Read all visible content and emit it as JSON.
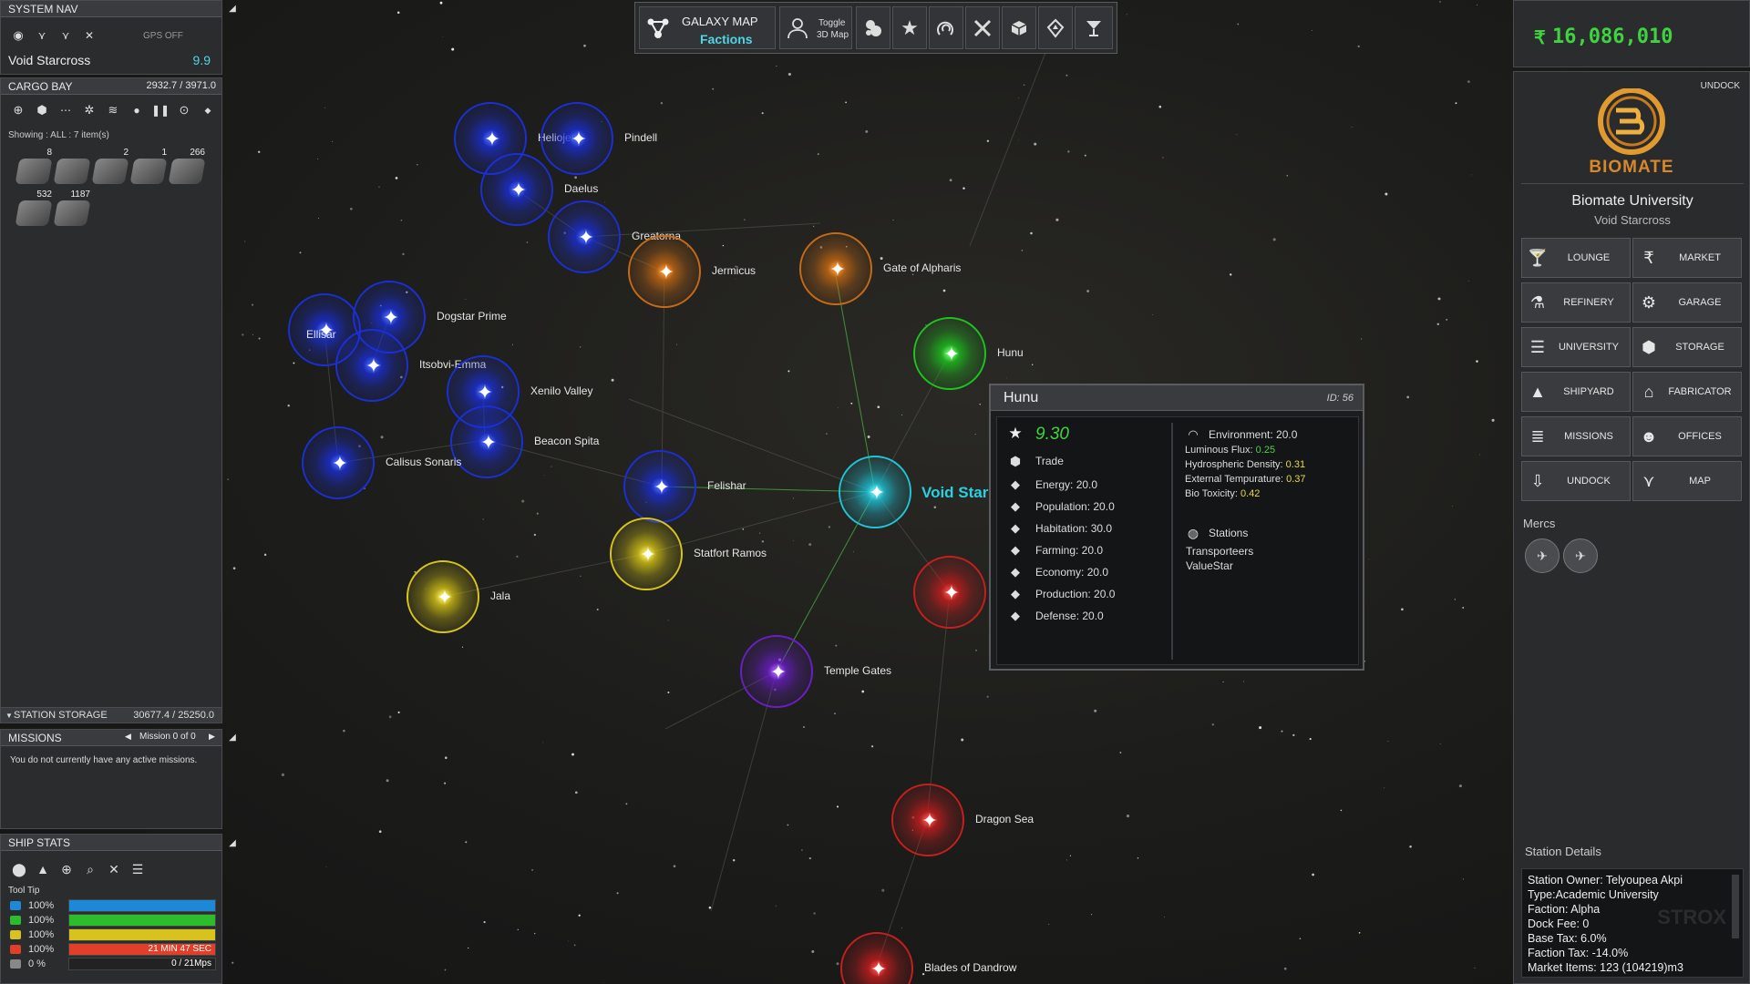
{
  "system_nav": {
    "header": "SYSTEM NAV",
    "gps": "GPS OFF",
    "system_name": "Void Starcross",
    "security": "9.9"
  },
  "cargo_bay": {
    "header": "CARGO BAY",
    "capacity": "2932.7 / 3971.0",
    "showing": "Showing : ALL : 7 item(s)",
    "item_counts": [
      "8",
      "",
      "2",
      "1",
      "266",
      "532",
      "1187"
    ]
  },
  "station_storage": {
    "label": "STATION STORAGE",
    "capacity": "30677.4 / 25250.0"
  },
  "missions": {
    "header": "MISSIONS",
    "nav_label": "Mission 0 of 0",
    "empty_text": "You do not currently have any active missions."
  },
  "ship_stats": {
    "header": "SHIP STATS",
    "tooltip_label": "Tool Tip",
    "rows": [
      {
        "icon": "shield-icon",
        "pct": "100%",
        "bar": "",
        "color": "#1e88d8",
        "fill": 1.0
      },
      {
        "icon": "energy-icon",
        "pct": "100%",
        "bar": "",
        "color": "#2bbd2b",
        "fill": 1.0
      },
      {
        "icon": "bolt-icon",
        "pct": "100%",
        "bar": "",
        "color": "#d8c21e",
        "fill": 1.0
      },
      {
        "icon": "timer-icon",
        "pct": "100%",
        "bar": "21 MIN 47 SEC",
        "color": "#e0402a",
        "fill": 1.0
      },
      {
        "icon": "speed-icon",
        "pct": "0 %",
        "bar": "0 / 21Mps",
        "color": "#555",
        "fill": 0.0
      }
    ]
  },
  "top_bar": {
    "title": "GALAXY MAP",
    "subtitle": "Factions",
    "toggle_line1": "Toggle",
    "toggle_line2": "3D Map"
  },
  "map": {
    "current_system_label": "Void Star",
    "nodes": [
      {
        "name": "Heliojen",
        "color": "blue"
      },
      {
        "name": "Pindell",
        "color": "blue"
      },
      {
        "name": "Daelus",
        "color": "blue"
      },
      {
        "name": "Greatorna",
        "color": "blue"
      },
      {
        "name": "Jermicus",
        "color": "orange"
      },
      {
        "name": "Gate of Alpharis",
        "color": "orange"
      },
      {
        "name": "Hunu",
        "color": "green"
      },
      {
        "name": "Dogstar Prime",
        "color": "blue"
      },
      {
        "name": "Ellisar",
        "color": "blue"
      },
      {
        "name": "Itsobvi-Emma",
        "color": "blue"
      },
      {
        "name": "Xenilo Valley",
        "color": "blue"
      },
      {
        "name": "Beacon Spita",
        "color": "blue"
      },
      {
        "name": "Calisus Sonaris",
        "color": "blue"
      },
      {
        "name": "Felishar",
        "color": "blue"
      },
      {
        "name": "Statfort Ramos",
        "color": "yellow"
      },
      {
        "name": "Jala",
        "color": "yellow"
      },
      {
        "name": "Temple Gates",
        "color": "purple"
      },
      {
        "name": "Dragon Sea",
        "color": "red"
      },
      {
        "name": "Blades of Dandrow",
        "color": "red"
      }
    ]
  },
  "info_popup": {
    "title": "Hunu",
    "id": "ID: 56",
    "rating": "9.30",
    "category": "Trade",
    "left_stats": [
      {
        "icon": "energy-icon",
        "text": "Energy: 20.0"
      },
      {
        "icon": "population-icon",
        "text": "Population: 20.0"
      },
      {
        "icon": "habitation-icon",
        "text": "Habitation: 30.0"
      },
      {
        "icon": "farming-icon",
        "text": "Farming: 20.0"
      },
      {
        "icon": "economy-icon",
        "text": "Economy: 20.0"
      },
      {
        "icon": "production-icon",
        "text": "Production: 20.0"
      },
      {
        "icon": "defense-icon",
        "text": "Defense: 20.0"
      }
    ],
    "environment": "Environment: 20.0",
    "env_stats": [
      {
        "label": "Luminous Flux: ",
        "value": "0.25",
        "color": "#4fd04f"
      },
      {
        "label": "Hydrospheric Density: ",
        "value": "0.31",
        "color": "#e8d84a"
      },
      {
        "label": "External Tempurature: ",
        "value": "0.37",
        "color": "#e8d84a"
      },
      {
        "label": "Bio Toxicity: ",
        "value": "0.42",
        "color": "#e8d84a"
      }
    ],
    "stations_label": "Stations",
    "stations": [
      "Transporteers",
      "ValueStar"
    ]
  },
  "right_panel": {
    "credits": "16,086,010",
    "undock_label": "UNDOCK",
    "logo_text": "BIOMATE",
    "station_name": "Biomate University",
    "system": "Void Starcross",
    "buttons": [
      {
        "label": "LOUNGE",
        "icon": "cocktail-icon"
      },
      {
        "label": "MARKET",
        "icon": "credits-icon"
      },
      {
        "label": "REFINERY",
        "icon": "refinery-icon"
      },
      {
        "label": "GARAGE",
        "icon": "garage-icon"
      },
      {
        "label": "UNIVERSITY",
        "icon": "book-icon"
      },
      {
        "label": "STORAGE",
        "icon": "crate-icon"
      },
      {
        "label": "SHIPYARD",
        "icon": "ship-icon"
      },
      {
        "label": "FABRICATOR",
        "icon": "fabricator-icon"
      },
      {
        "label": "MISSIONS",
        "icon": "missions-icon"
      },
      {
        "label": "OFFICES",
        "icon": "people-icon"
      },
      {
        "label": "UNDOCK",
        "icon": "undock-icon"
      },
      {
        "label": "MAP",
        "icon": "map-icon"
      }
    ],
    "mercs_label": "Mercs",
    "details_label": "Station Details",
    "details": [
      "Station Owner: Telyoupea Akpi",
      "Type:Academic University",
      "Faction: Alpha",
      "Dock Fee: 0",
      "Base Tax: 6.0%",
      "Faction Tax: -14.0%",
      "Market Items: 123 (104219)m3"
    ],
    "watermark": "STROX"
  }
}
